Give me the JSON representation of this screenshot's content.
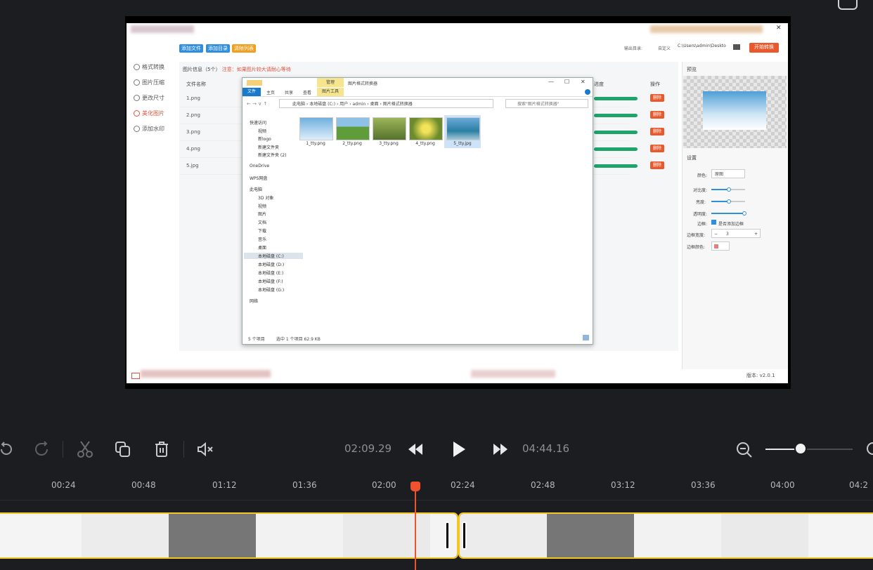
{
  "screenshot": {
    "toolbar": {
      "add_file": "添加文件",
      "add_folder": "添加目录",
      "clear_list": "清除列表"
    },
    "output": {
      "label": "输出目录:",
      "option": "自定义",
      "path": "C:\\Users\\admin\\Deskto",
      "start": "开始转换"
    },
    "sidebar": [
      {
        "label": "格式转换",
        "icon": "convert-icon"
      },
      {
        "label": "图片压缩",
        "icon": "compress-icon"
      },
      {
        "label": "更改尺寸",
        "icon": "resize-icon"
      },
      {
        "label": "美化图片",
        "icon": "beautify-icon"
      },
      {
        "label": "添加水印",
        "icon": "watermark-icon"
      }
    ],
    "info_title": "图片信息（5个）",
    "info_note": "注意：如果图片较大请耐心等待",
    "table_headers": {
      "filename": "文件名称",
      "progress": "进度",
      "action": "操作"
    },
    "files": [
      "1.png",
      "2.png",
      "3.png",
      "4.png",
      "5.jpg"
    ],
    "delete_label": "删除",
    "preview_title": "预览",
    "settings_title": "设置",
    "settings": {
      "color_label": "颜色:",
      "color_value": "原图",
      "contrast_label": "对比度:",
      "brightness_label": "亮度:",
      "opacity_label": "透明度:",
      "border_label": "边框:",
      "border_check": "是否添加边框",
      "border_width_label": "边框宽度:",
      "border_width_value": "3",
      "minus": "−",
      "plus": "+",
      "border_color_label": "边框颜色:"
    },
    "version": "版本: v2.0.1"
  },
  "explorer": {
    "title": "图片格式转换器",
    "manage_tab": "管理",
    "ribbon": [
      "文件",
      "主页",
      "共享",
      "查看",
      "图片工具"
    ],
    "breadcrumb": [
      "此电脑",
      "本地磁盘 (C:)",
      "用户",
      "admin",
      "桌面",
      "图片格式转换器"
    ],
    "search_placeholder": "搜索\"图片格式转换器\"",
    "nav": [
      "快速访问",
      "视频",
      "新logo",
      "新建文件夹",
      "新建文件夹 (2)",
      "OneDrive",
      "WPS网盘",
      "此电脑",
      "3D 对象",
      "视频",
      "图片",
      "文档",
      "下载",
      "音乐",
      "桌面",
      "本地磁盘 (C:)",
      "本地磁盘 (D:)",
      "本地磁盘 (E:)",
      "本地磁盘 (F:)",
      "本地磁盘 (G:)",
      "网络"
    ],
    "files": [
      "1_tty.png",
      "2_tty.png",
      "3_tty.png",
      "4_tty.png",
      "5_tty.jpg"
    ],
    "status_count": "5 个项目",
    "status_selected": "选中 1 个项目  62.9 KB",
    "window_controls": {
      "min": "—",
      "max": "☐",
      "close": "✕"
    }
  },
  "player": {
    "current_time": "02:09.29",
    "total_time": "04:44.16",
    "zoom_level": 0.4
  },
  "timeline": {
    "ticks": [
      "00:24",
      "00:48",
      "01:12",
      "01:36",
      "02:00",
      "02:24",
      "02:48",
      "03:12",
      "03:36",
      "04:00",
      "04:2"
    ],
    "playhead_time": "02:09.29"
  },
  "colors": {
    "accent": "#f3c623",
    "playhead": "#f0522d",
    "primary_btn": "#e85a2d",
    "progress": "#1ea36a"
  }
}
